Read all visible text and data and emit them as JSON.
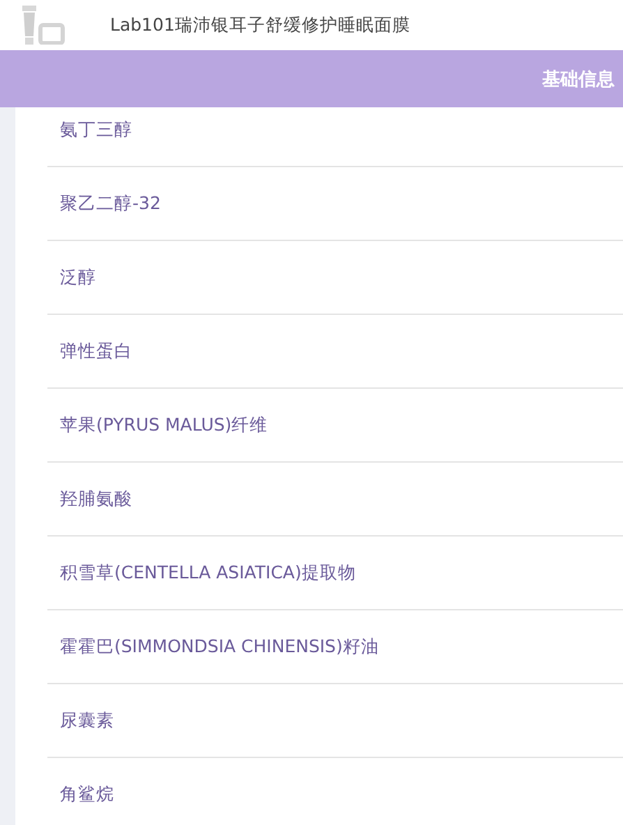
{
  "header": {
    "title": "Lab101瑞沛银耳子舒缓修护睡眠面膜"
  },
  "section_bar": {
    "label": "基础信息"
  },
  "ingredients": [
    "氨丁三醇",
    "聚乙二醇-32",
    "泛醇",
    "弹性蛋白",
    "苹果(PYRUS MALUS)纤维",
    "羟脯氨酸",
    "积雪草(CENTELLA ASIATICA)提取物",
    "霍霍巴(SIMMONDSIA CHINENSIS)籽油",
    "尿囊素",
    "角鲨烷"
  ]
}
